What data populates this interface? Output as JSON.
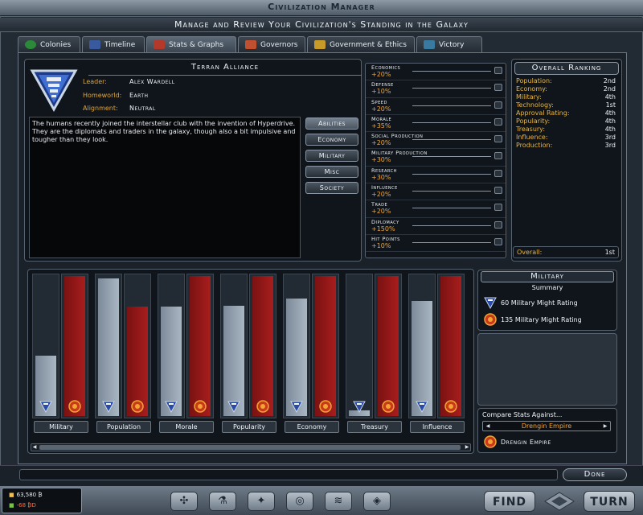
{
  "window": {
    "title": "Civilization Manager",
    "subtitle": "Manage and Review Your Civilization's Standing in the Galaxy"
  },
  "tabs": [
    {
      "label": "Colonies",
      "icon": "planet-icon",
      "color": "#2a8a3a"
    },
    {
      "label": "Timeline",
      "icon": "timeline-icon",
      "color": "#3a5aa0"
    },
    {
      "label": "Stats & Graphs",
      "icon": "graph-icon",
      "color": "#b33a2a"
    },
    {
      "label": "Governors",
      "icon": "arrows-icon",
      "color": "#c05030"
    },
    {
      "label": "Government & Ethics",
      "icon": "scales-icon",
      "color": "#c89a2a"
    },
    {
      "label": "Victory",
      "icon": "flag-icon",
      "color": "#3a7aa0"
    }
  ],
  "race": {
    "name": "Terran Alliance",
    "leader_label": "Leader:",
    "leader": "Alex Wardell",
    "homeworld_label": "Homeworld:",
    "homeworld": "Earth",
    "alignment_label": "Alignment:",
    "alignment": "Neutral",
    "description": "The humans recently joined the interstellar club with the invention of Hyperdrive. They are the diplomats and traders in the galaxy, though also a bit impulsive and tougher than they look."
  },
  "categories": [
    "Abilities",
    "Economy",
    "Military",
    "Misc",
    "Society"
  ],
  "abilities": [
    {
      "name": "Economics",
      "value": "+20%"
    },
    {
      "name": "Defense",
      "value": "+10%"
    },
    {
      "name": "Speed",
      "value": "+20%"
    },
    {
      "name": "Morale",
      "value": "+35%"
    },
    {
      "name": "Social Production",
      "value": "+20%"
    },
    {
      "name": "Military Production",
      "value": "+30%"
    },
    {
      "name": "Research",
      "value": "+30%"
    },
    {
      "name": "Influence",
      "value": "+20%"
    },
    {
      "name": "Trade",
      "value": "+20%"
    },
    {
      "name": "Diplomacy",
      "value": "+150%"
    },
    {
      "name": "Hit Points",
      "value": "+10%"
    }
  ],
  "ranking": {
    "title": "Overall Ranking",
    "rows": [
      {
        "label": "Population:",
        "value": "2nd"
      },
      {
        "label": "Economy:",
        "value": "2nd"
      },
      {
        "label": "Military:",
        "value": "4th"
      },
      {
        "label": "Technology:",
        "value": "1st"
      },
      {
        "label": "Approval Rating:",
        "value": "4th"
      },
      {
        "label": "Popularity:",
        "value": "4th"
      },
      {
        "label": "Treasury:",
        "value": "4th"
      },
      {
        "label": "Influence:",
        "value": "3rd"
      },
      {
        "label": "Production:",
        "value": "3rd"
      }
    ],
    "overall_label": "Overall:",
    "overall_value": "1st"
  },
  "graphs": [
    {
      "label": "Military",
      "player": 0.43,
      "rival": 1.0
    },
    {
      "label": "Population",
      "player": 0.98,
      "rival": 0.78
    },
    {
      "label": "Morale",
      "player": 0.78,
      "rival": 1.0
    },
    {
      "label": "Popularity",
      "player": 0.79,
      "rival": 1.0
    },
    {
      "label": "Economy",
      "player": 0.84,
      "rival": 1.0
    },
    {
      "label": "Treasury",
      "player": 0.04,
      "rival": 1.0
    },
    {
      "label": "Influence",
      "player": 0.82,
      "rival": 1.0
    }
  ],
  "colors": {
    "player_bar": "#a9b6c3",
    "rival_bar": "#a81d1d",
    "accent": "#e0a537"
  },
  "military": {
    "title": "Military",
    "subtitle": "Summary",
    "player_rating": "60 Military Might Rating",
    "rival_rating": "135 Military Might Rating"
  },
  "compare": {
    "label": "Compare Stats Against...",
    "selected": "Drengin Empire",
    "empire": "Drengin Empire"
  },
  "done_label": "Done",
  "resources": {
    "credits": "63,580 ₿",
    "income": "-68 ₿D"
  },
  "footer": {
    "find": "FIND",
    "turn": "TURN"
  }
}
